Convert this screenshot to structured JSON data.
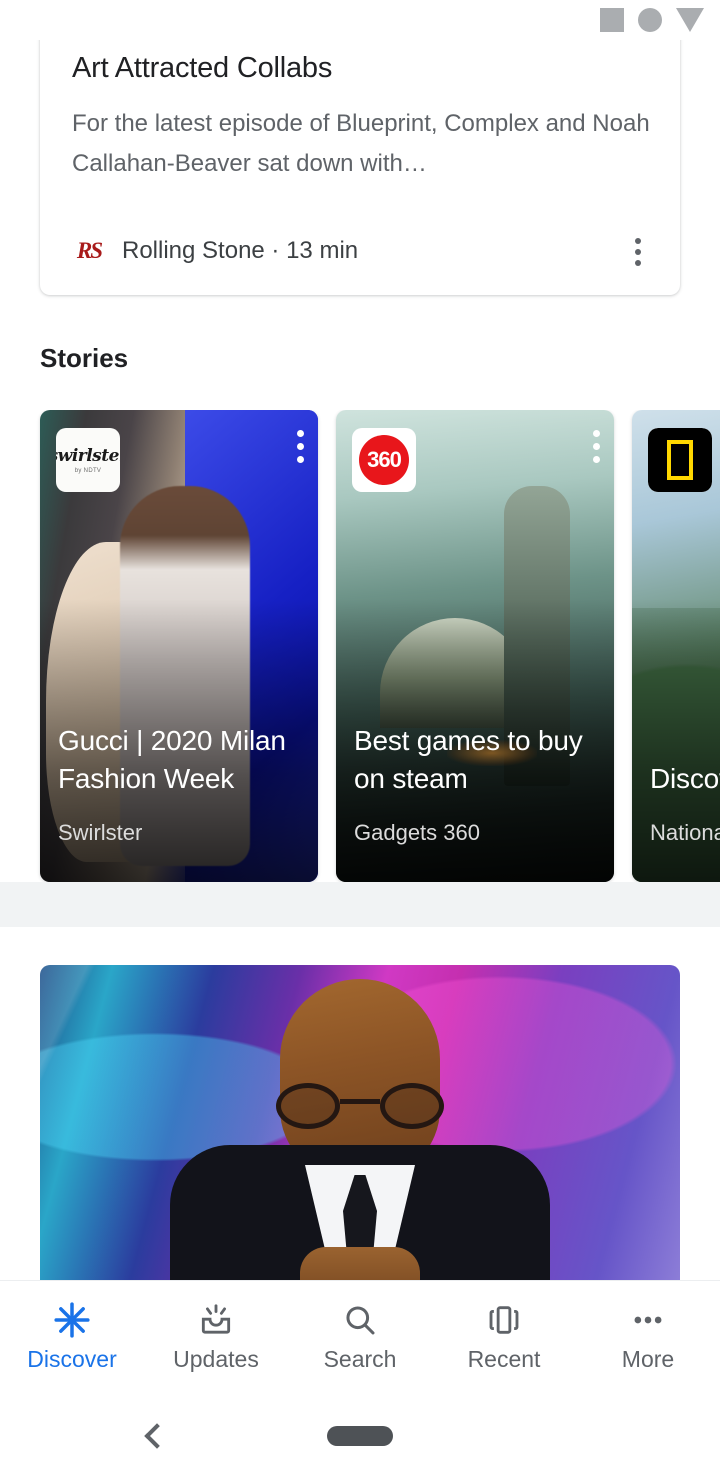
{
  "status_bar": {
    "icons": [
      "square-icon",
      "circle-icon",
      "triangle-down-icon"
    ]
  },
  "article_card": {
    "clipped_line_above": "",
    "title": "Art Attracted Collabs",
    "snippet": "For the latest episode of Blueprint, Complex and Noah Callahan-Beaver sat down with…",
    "source": "Rolling Stone",
    "separator": "·",
    "read_time": "13 min",
    "meta_line": "Rolling Stone · 13 min",
    "publisher_logo": "rolling-stone-logo",
    "menu_icon": "overflow-menu-icon"
  },
  "stories": {
    "header": "Stories",
    "cards": [
      {
        "title": "Gucci | 2020 Milan Fashion Week",
        "source": "Swirlster",
        "logo": "swirlster-logo",
        "logo_text": "swirlster",
        "logo_subtext": "by NDTV",
        "menu_icon": "overflow-menu-icon",
        "artwork": "fashion-model-photo"
      },
      {
        "title": "Best games to buy on steam",
        "source": "Gadgets 360",
        "logo": "gadgets-360-logo",
        "logo_text": "360",
        "menu_icon": "overflow-menu-icon",
        "artwork": "game-temple-artwork"
      },
      {
        "title": "Discover hidden",
        "source": "National Geographic",
        "logo": "national-geographic-logo",
        "menu_icon": "overflow-menu-icon",
        "artwork": "nature-landscape-photo"
      }
    ]
  },
  "photo_card": {
    "image_description": "portrait-of-man-in-suit-with-glasses"
  },
  "bottom_nav": {
    "items": [
      {
        "label": "Discover",
        "icon": "discover-asterisk-icon",
        "active": true
      },
      {
        "label": "Updates",
        "icon": "updates-inbox-icon",
        "active": false
      },
      {
        "label": "Search",
        "icon": "search-icon",
        "active": false
      },
      {
        "label": "Recent",
        "icon": "recent-cards-icon",
        "active": false
      },
      {
        "label": "More",
        "icon": "more-dots-icon",
        "active": false
      }
    ],
    "active_color": "#1a73e8",
    "inactive_color": "#5f6368"
  },
  "system_nav": {
    "back_icon": "back-chevron-icon",
    "home_icon": "home-pill-icon"
  }
}
